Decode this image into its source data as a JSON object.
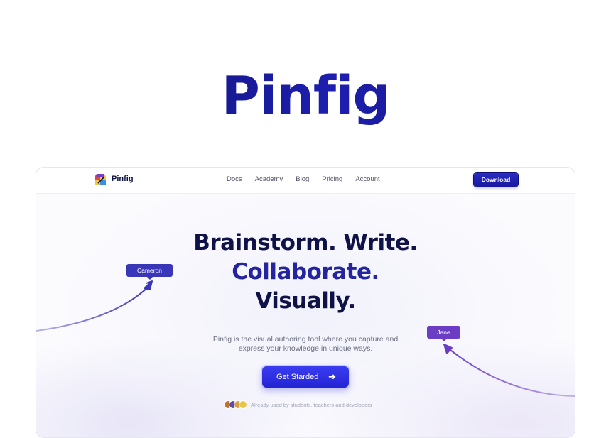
{
  "hero": {
    "title": "Pinfig"
  },
  "navbar": {
    "brand": "Pinfig",
    "links": [
      "Docs",
      "Academy",
      "Blog",
      "Pricing",
      "Account"
    ],
    "download_label": "Download"
  },
  "main": {
    "headline_line1": "Brainstorm. Write.",
    "headline_line2": "Collaborate.",
    "headline_line3": "Visually.",
    "subtitle_line1": "Pinfig is the visual authoring tool where you capture and",
    "subtitle_line2": "express your knowledge in unique ways.",
    "cta_label": "Get Starded",
    "social_proof": "Already used by students, teachers and developers"
  },
  "cursors": [
    {
      "name": "Cameron",
      "color": "#3a36b8"
    },
    {
      "name": "Jane",
      "color": "#6a3dc4"
    }
  ],
  "colors": {
    "brand_dark": "#0f1247",
    "brand_accent": "#23249e",
    "button_primary": "#2325d4"
  },
  "icons": {
    "cta_arrow": "arrow-right-icon",
    "logo": "pinfig-logo-icon"
  }
}
